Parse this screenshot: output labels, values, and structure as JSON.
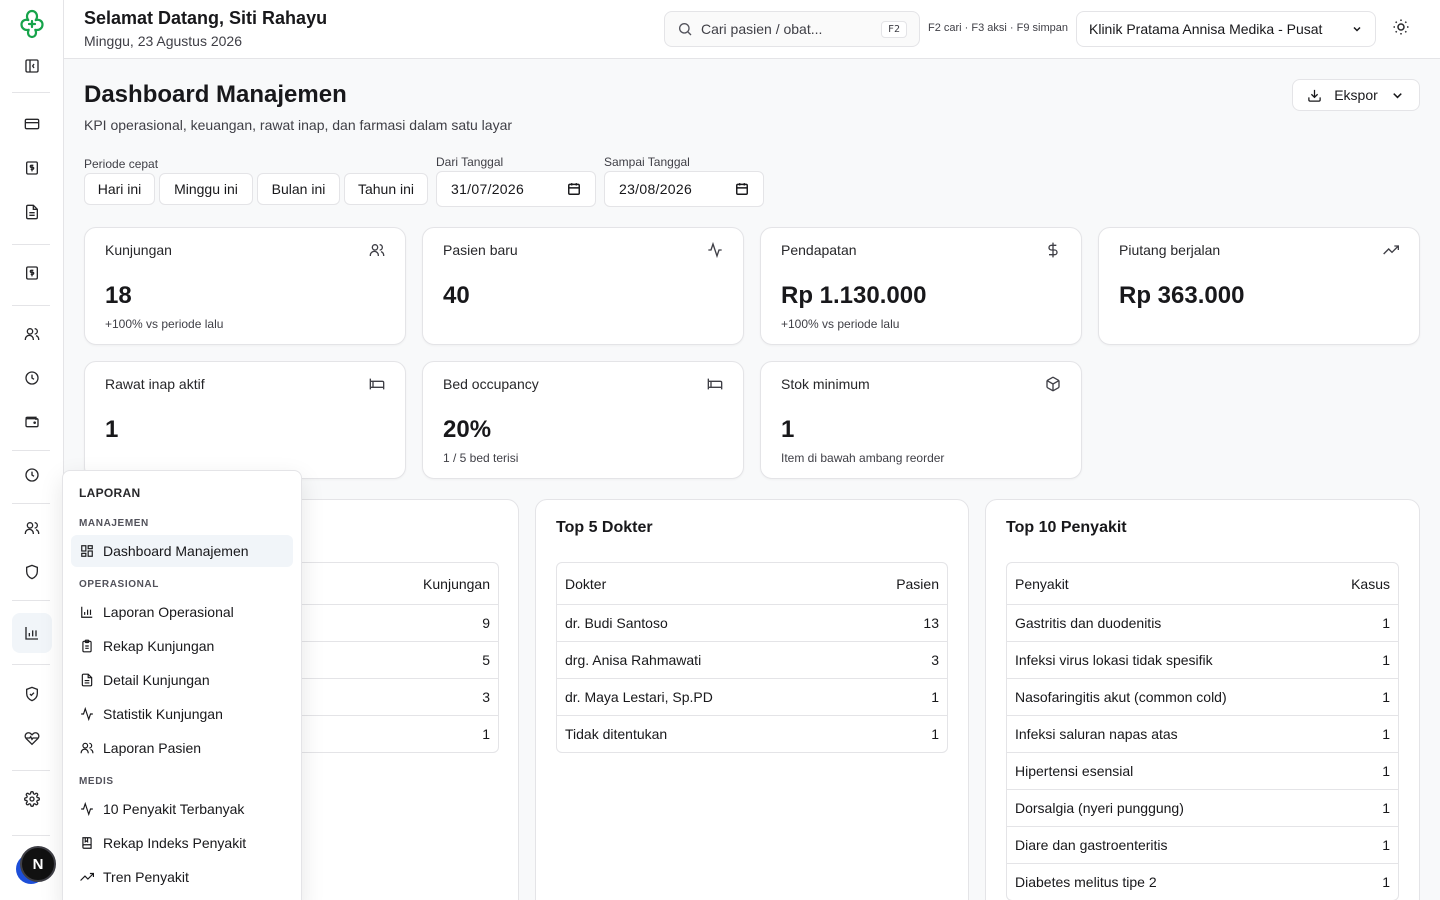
{
  "header": {
    "greeting": "Selamat Datang, Siti Rahayu",
    "date": "Minggu, 23 Agustus 2026",
    "search_placeholder": "Cari pasien / obat...",
    "search_shortcut": "F2",
    "shortcut_hints": "F2 cari · F3 aksi · F9 simpan",
    "clinic": "Klinik Pratama Annisa Medika - Pusat",
    "user_initial": "N"
  },
  "page": {
    "title": "Dashboard Manajemen",
    "subtitle": "KPI operasional, keuangan, rawat inap, dan farmasi dalam satu layar",
    "export_label": "Ekspor"
  },
  "filters": {
    "quick_label": "Periode cepat",
    "quick": [
      "Hari ini",
      "Minggu ini",
      "Bulan ini",
      "Tahun ini"
    ],
    "from_label": "Dari Tanggal",
    "from_value": "31/07/2026",
    "to_label": "Sampai Tanggal",
    "to_value": "23/08/2026"
  },
  "kpis": [
    {
      "label": "Kunjungan",
      "value": "18",
      "sub": "+100% vs periode lalu",
      "icon": "users-icon"
    },
    {
      "label": "Pasien baru",
      "value": "40",
      "sub": "",
      "icon": "activity-icon"
    },
    {
      "label": "Pendapatan",
      "value": "Rp 1.130.000",
      "sub": "+100% vs periode lalu",
      "icon": "dollar-icon"
    },
    {
      "label": "Piutang berjalan",
      "value": "Rp 363.000",
      "sub": "",
      "icon": "trending-up-icon"
    },
    {
      "label": "Rawat inap aktif",
      "value": "1",
      "sub": "",
      "icon": "bed-icon"
    },
    {
      "label": "Bed occupancy",
      "value": "20%",
      "sub": "1 / 5 bed terisi",
      "icon": "bed-icon"
    },
    {
      "label": "Stok minimum",
      "value": "1",
      "sub": "Item di bawah ambang reorder",
      "icon": "package-icon"
    }
  ],
  "panels": {
    "first": {
      "col_value": "Kunjungan",
      "values": [
        "9",
        "5",
        "3",
        "1"
      ]
    },
    "doctors": {
      "title": "Top 5 Dokter",
      "col_name": "Dokter",
      "col_value": "Pasien",
      "rows": [
        {
          "name": "dr. Budi Santoso",
          "value": "13"
        },
        {
          "name": "drg. Anisa Rahmawati",
          "value": "3"
        },
        {
          "name": "dr. Maya Lestari, Sp.PD",
          "value": "1"
        },
        {
          "name": "Tidak ditentukan",
          "value": "1"
        }
      ]
    },
    "diseases": {
      "title": "Top 10 Penyakit",
      "col_name": "Penyakit",
      "col_value": "Kasus",
      "rows": [
        {
          "name": "Gastritis dan duodenitis",
          "value": "1"
        },
        {
          "name": "Infeksi virus lokasi tidak spesifik",
          "value": "1"
        },
        {
          "name": "Nasofaringitis akut (common cold)",
          "value": "1"
        },
        {
          "name": "Infeksi saluran napas atas",
          "value": "1"
        },
        {
          "name": "Hipertensi esensial",
          "value": "1"
        },
        {
          "name": "Dorsalgia (nyeri punggung)",
          "value": "1"
        },
        {
          "name": "Diare dan gastroenteritis",
          "value": "1"
        },
        {
          "name": "Diabetes melitus tipe 2",
          "value": "1"
        }
      ]
    }
  },
  "menu": {
    "heading": "LAPORAN",
    "sections": [
      {
        "title": "MANAJEMEN",
        "items": [
          {
            "label": "Dashboard Manajemen",
            "icon": "dashboard-icon"
          }
        ]
      },
      {
        "title": "OPERASIONAL",
        "items": [
          {
            "label": "Laporan Operasional",
            "icon": "bar-chart-icon"
          },
          {
            "label": "Rekap Kunjungan",
            "icon": "clipboard-icon"
          },
          {
            "label": "Detail Kunjungan",
            "icon": "file-text-icon"
          },
          {
            "label": "Statistik Kunjungan",
            "icon": "activity-icon"
          },
          {
            "label": "Laporan Pasien",
            "icon": "users-icon"
          }
        ]
      },
      {
        "title": "MEDIS",
        "items": [
          {
            "label": "10 Penyakit Terbanyak",
            "icon": "activity-icon"
          },
          {
            "label": "Rekap Indeks Penyakit",
            "icon": "book-icon"
          },
          {
            "label": "Tren Penyakit",
            "icon": "trending-up-icon"
          }
        ]
      }
    ]
  }
}
